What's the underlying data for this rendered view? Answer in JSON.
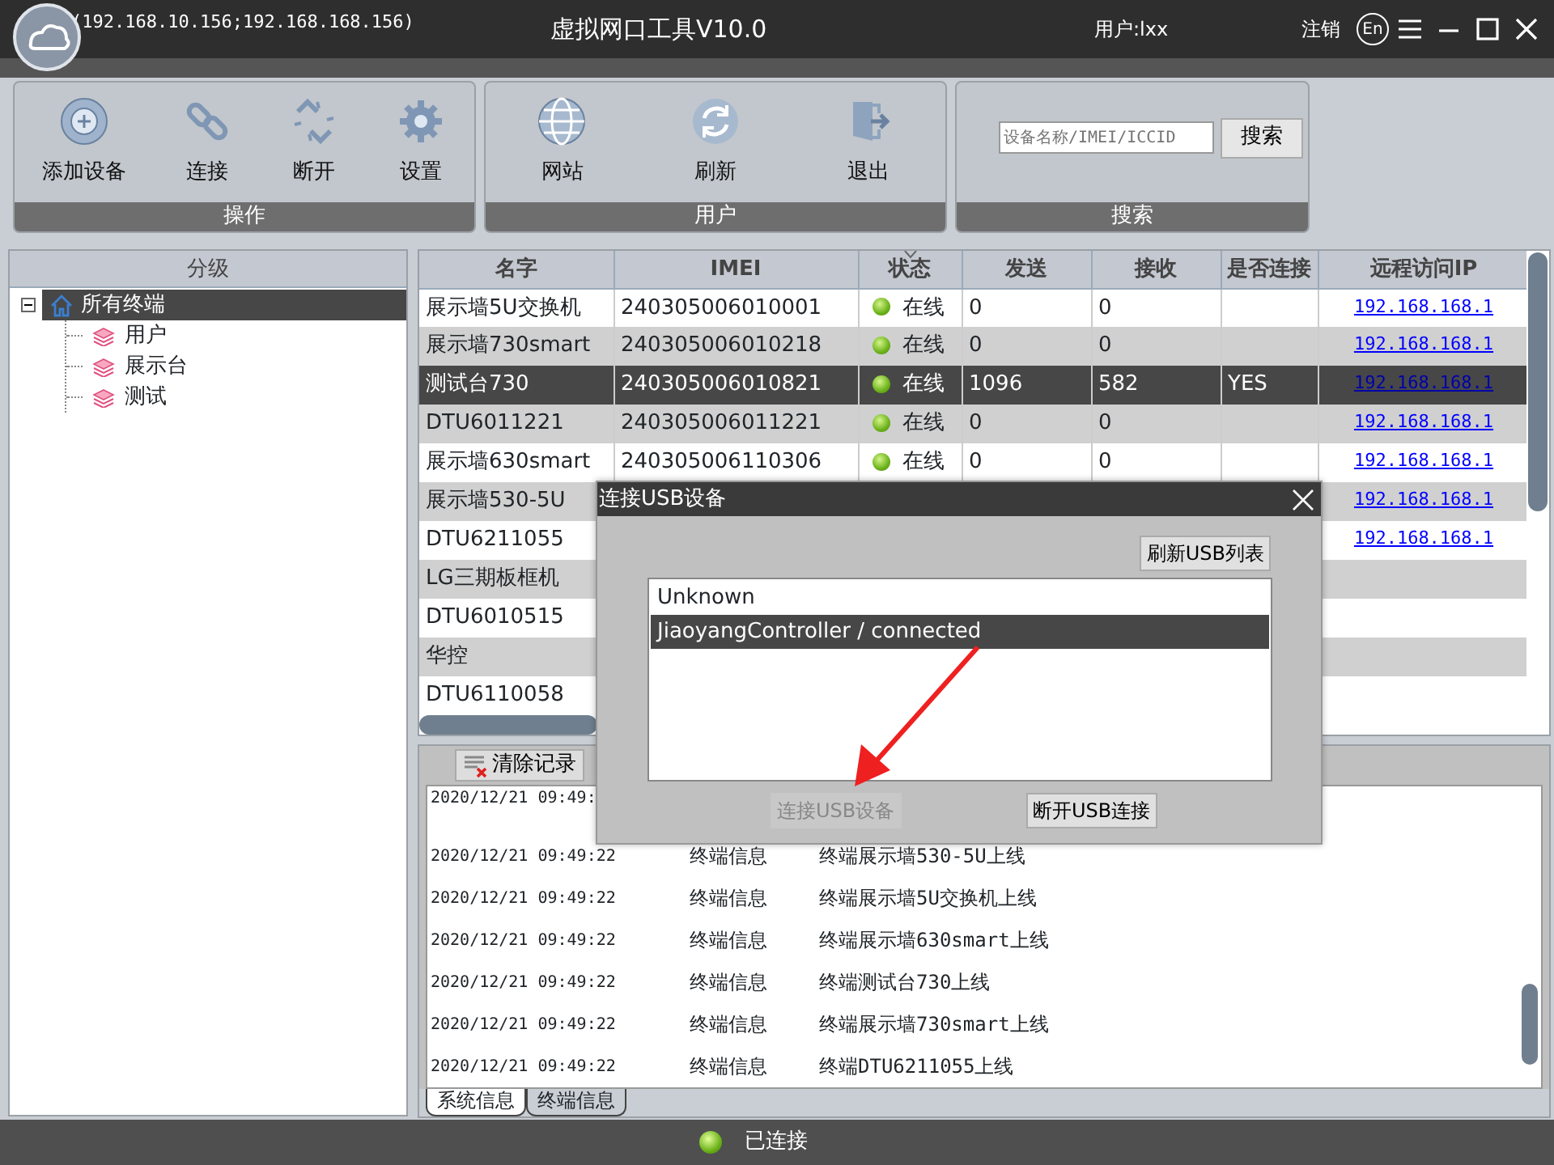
{
  "window": {
    "addresses": "(192.168.10.156;192.168.168.156)",
    "title": "虚拟网口工具V10.0",
    "user": "用户:lxx",
    "logout": "注销",
    "language": "En"
  },
  "toolbar": [
    {
      "label": "操作",
      "kind": "buttons",
      "buttons": [
        {
          "label": "添加设备"
        },
        {
          "label": "连接"
        },
        {
          "label": "断开"
        },
        {
          "label": "设置"
        }
      ]
    },
    {
      "label": "用户",
      "kind": "buttons",
      "buttons": [
        {
          "label": "网站"
        },
        {
          "label": "刷新"
        },
        {
          "label": "退出"
        }
      ]
    },
    {
      "label": "搜索",
      "kind": "search",
      "placeholder": "设备名称/IMEI/ICCID",
      "button": "搜索"
    }
  ],
  "tree": {
    "header": "分级",
    "root": {
      "label": "所有终端",
      "selected": true,
      "expanded": true,
      "children": [
        {
          "label": "用户",
          "selected": false
        },
        {
          "label": "展示台",
          "selected": false
        },
        {
          "label": "测试",
          "selected": false
        }
      ]
    }
  },
  "table": {
    "columns": [
      "名字",
      "IMEI",
      "状态",
      "发送",
      "接收",
      "是否连接",
      "远程访问IP"
    ],
    "rows": [
      {
        "name": "展示墙5U交换机",
        "imei": "240305006010001",
        "online": true,
        "status": "在线",
        "sent": "0",
        "received": "0",
        "ip": "192.168.168.1",
        "selected": false
      },
      {
        "name": "展示墙730smart",
        "imei": "240305006010218",
        "online": true,
        "status": "在线",
        "sent": "0",
        "received": "0",
        "ip": "192.168.168.1",
        "selected": false
      },
      {
        "name": "测试台730",
        "imei": "240305006010821",
        "online": true,
        "status": "在线",
        "sent": "1096",
        "received": "582",
        "connected": "YES",
        "ip": "192.168.168.1",
        "selected": true
      },
      {
        "name": "DTU6011221",
        "imei": "240305006011221",
        "online": true,
        "status": "在线",
        "sent": "0",
        "received": "0",
        "ip": "192.168.168.1",
        "selected": false
      },
      {
        "name": "展示墙630smart",
        "imei": "240305006110306",
        "online": true,
        "status": "在线",
        "sent": "0",
        "received": "0",
        "ip": "192.168.168.1",
        "selected": false
      },
      {
        "name": "展示墙530-5U",
        "ip": "192.168.168.1",
        "selected": false
      },
      {
        "name": "DTU6211055",
        "ip": "192.168.168.1",
        "selected": false
      },
      {
        "name": "LG三期板框机",
        "selected": false
      },
      {
        "name": "DTU6010515",
        "selected": false
      },
      {
        "name": "华控",
        "selected": false
      },
      {
        "name": "DTU6110058",
        "selected": false
      }
    ]
  },
  "log": {
    "clear_button": "清除记录",
    "entries": [
      {
        "time": "2020/12/21 09:49:"
      },
      {
        "time": "2020/12/21 09:49:22",
        "category": "终端信息",
        "message": "终端展示墙530-5U上线"
      },
      {
        "time": "2020/12/21 09:49:22",
        "category": "终端信息",
        "message": "终端展示墙5U交换机上线"
      },
      {
        "time": "2020/12/21 09:49:22",
        "category": "终端信息",
        "message": "终端展示墙630smart上线"
      },
      {
        "time": "2020/12/21 09:49:22",
        "category": "终端信息",
        "message": "终端测试台730上线"
      },
      {
        "time": "2020/12/21 09:49:22",
        "category": "终端信息",
        "message": "终端展示墙730smart上线"
      },
      {
        "time": "2020/12/21 09:49:22",
        "category": "终端信息",
        "message": "终端DTU6211055上线"
      }
    ],
    "tabs": [
      {
        "label": "系统信息",
        "selected": true
      },
      {
        "label": "终端信息",
        "selected": false
      }
    ]
  },
  "status_bar": {
    "text": "已连接",
    "connected": true
  },
  "dialog": {
    "title": "连接USB设备",
    "refresh_button": "刷新USB列表",
    "devices": [
      {
        "label": "Unknown",
        "selected": false
      },
      {
        "label": "JiaoyangController / connected",
        "selected": true
      }
    ],
    "buttons": [
      {
        "label": "连接USB设备",
        "disabled": true
      },
      {
        "label": "断开USB连接",
        "disabled": false
      }
    ]
  }
}
